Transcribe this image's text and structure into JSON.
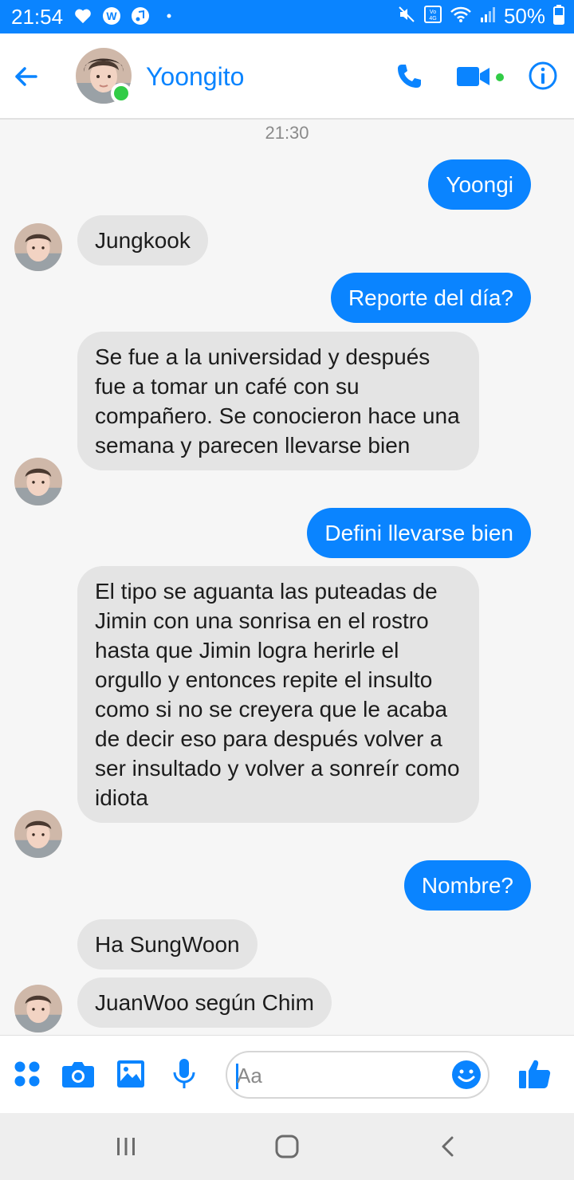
{
  "status_bar": {
    "time": "21:54",
    "battery": "50%",
    "left_icons": [
      "heart-icon",
      "w-app-icon",
      "music-icon",
      "dot-icon"
    ],
    "right_icons": [
      "mute-icon",
      "volte-4g-icon",
      "wifi-icon",
      "signal-icon",
      "battery-icon"
    ]
  },
  "header": {
    "contact_name": "Yoongito",
    "online": true
  },
  "chat": {
    "timestamp": "21:30",
    "messages": [
      {
        "side": "out",
        "text": "Yoongi"
      },
      {
        "side": "in",
        "text": "Jungkook"
      },
      {
        "side": "out",
        "text": "Reporte del día?"
      },
      {
        "side": "in",
        "text": "Se fue a la universidad y después fue a tomar un café con su compañero. Se conocieron hace una semana y parecen llevarse bien"
      },
      {
        "side": "out",
        "text": "Defini llevarse bien"
      },
      {
        "side": "in",
        "text": "El tipo se aguanta las puteadas de Jimin con una sonrisa en el rostro hasta que Jimin logra herirle el orgullo y entonces repite el insulto como si no se creyera que le acaba de decir eso para después volver a ser insultado y volver a sonreír como idiota"
      },
      {
        "side": "out",
        "text": "Nombre?"
      },
      {
        "side": "in",
        "text": "Ha SungWoon"
      },
      {
        "side": "in",
        "text": "JuanWoo según Chim"
      }
    ]
  },
  "composer": {
    "placeholder": "Aa",
    "value": ""
  },
  "colors": {
    "accent": "#0a84ff",
    "incoming_bubble": "#e4e4e4",
    "online_green": "#31cc46"
  }
}
